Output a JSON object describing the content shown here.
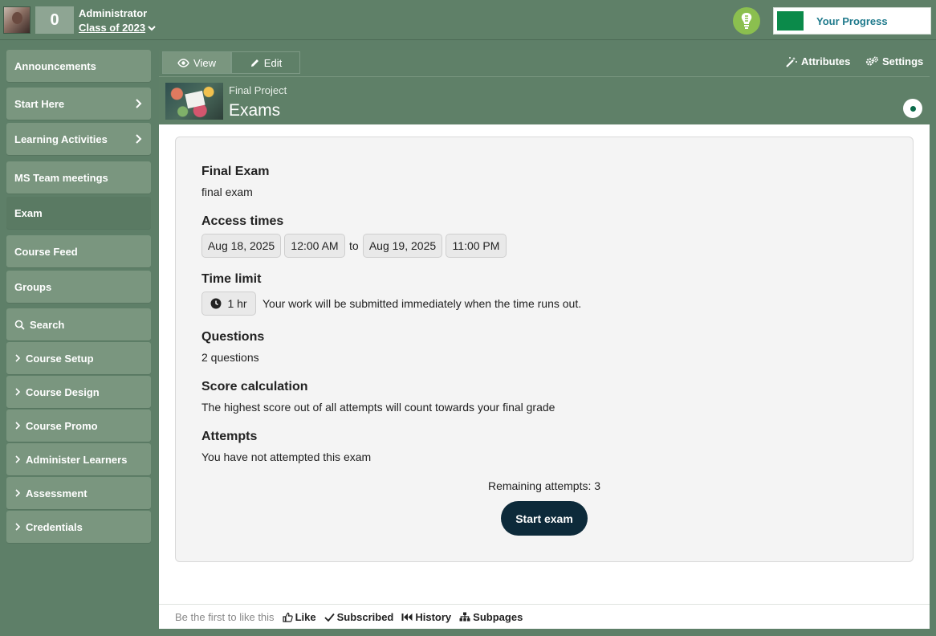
{
  "header": {
    "notification_count": "0",
    "user_role": "Administrator",
    "class_name": "Class of 2023",
    "progress_label": "Your Progress",
    "progress_fraction": 0.17,
    "brand_green": "#0b8a4a"
  },
  "sidebar": {
    "items": [
      {
        "label": "Announcements"
      },
      {
        "label": "Start Here"
      },
      {
        "label": "Learning Activities"
      },
      {
        "label": "MS Team meetings"
      },
      {
        "label": "Exam"
      },
      {
        "label": "Course Feed"
      },
      {
        "label": "Groups"
      },
      {
        "label": "Search"
      },
      {
        "label": "Course Setup"
      },
      {
        "label": "Course Design"
      },
      {
        "label": "Course Promo"
      },
      {
        "label": "Administer Learners"
      },
      {
        "label": "Assessment"
      },
      {
        "label": "Credentials"
      }
    ],
    "active_item": "Exam"
  },
  "toolbar": {
    "view_label": "View",
    "edit_label": "Edit",
    "attributes_label": "Attributes",
    "settings_label": "Settings"
  },
  "page": {
    "breadcrumb": "Final Project",
    "title": "Exams"
  },
  "exam": {
    "name_heading": "Final Exam",
    "name_text": "final exam",
    "access_heading": "Access times",
    "start_date": "Aug 18, 2025",
    "start_time": "12:00 AM",
    "to_word": "to",
    "end_date": "Aug 19, 2025",
    "end_time": "11:00 PM",
    "time_limit_heading": "Time limit",
    "time_limit_value": "1 hr",
    "time_limit_note": "Your work will be submitted immediately when the time runs out.",
    "questions_heading": "Questions",
    "questions_text": "2 questions",
    "score_heading": "Score calculation",
    "score_text": "The highest score out of all attempts will count towards your final grade",
    "attempts_heading": "Attempts",
    "attempts_text": "You have not attempted this exam",
    "remaining_text": "Remaining attempts: 3",
    "start_button": "Start exam"
  },
  "footer": {
    "first_like_text": "Be the first to like this",
    "like_label": "Like",
    "subscribed_label": "Subscribed",
    "history_label": "History",
    "subpages_label": "Subpages"
  }
}
